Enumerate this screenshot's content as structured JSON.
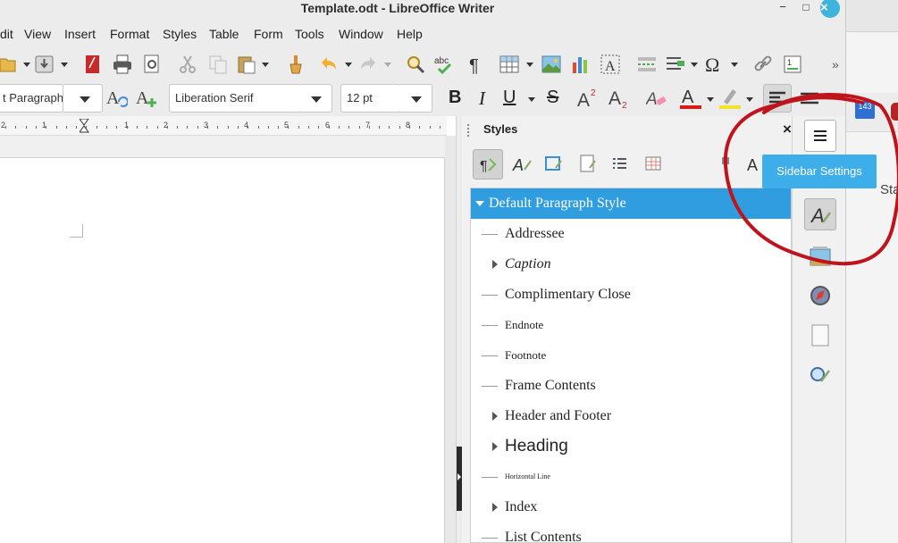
{
  "window": {
    "title": "Template.odt - LibreOffice Writer",
    "minimize": "−",
    "maximize": "□",
    "close": "×"
  },
  "menubar": {
    "items": [
      "dit",
      "View",
      "Insert",
      "Format",
      "Styles",
      "Table",
      "Form",
      "Tools",
      "Window",
      "Help"
    ]
  },
  "toolbar2": {
    "paragraph_style": "t Paragraph",
    "font_name": "Liberation Serif",
    "font_size": "12 pt",
    "bold": "B",
    "italic": "I",
    "underline": "U",
    "strikethrough": "S"
  },
  "ruler": {
    "numbers": [
      "2",
      "1",
      "1",
      "2",
      "3",
      "4",
      "5",
      "6",
      "7",
      "8"
    ]
  },
  "sidebar": {
    "deck_title": "Styles",
    "close": "×",
    "tooltip": "Sidebar Settings",
    "styles": [
      {
        "name": "Default Paragraph Style",
        "selected": true,
        "expandable": true,
        "expanded": true
      },
      {
        "name": "Addressee",
        "expandable": false
      },
      {
        "name": "Caption",
        "expandable": true,
        "italic": true
      },
      {
        "name": "Complimentary Close",
        "expandable": false
      },
      {
        "name": "Endnote",
        "expandable": false,
        "small": true
      },
      {
        "name": "Footnote",
        "expandable": false,
        "small": true
      },
      {
        "name": "Frame Contents",
        "expandable": false
      },
      {
        "name": "Header and Footer",
        "expandable": true
      },
      {
        "name": "Heading",
        "expandable": true,
        "heading": true
      },
      {
        "name": "Horizontal Line",
        "expandable": false,
        "tiny": true
      },
      {
        "name": "Index",
        "expandable": true
      },
      {
        "name": "List Contents",
        "expandable": false
      }
    ]
  },
  "right_window": {
    "badge": "143",
    "partial_text": "Sta"
  },
  "colors": {
    "accent": "#3daee9",
    "selection": "#2f9de0",
    "annotation": "#c0141c",
    "font_color": "#d81b1b",
    "highlight": "#f2e32b"
  }
}
